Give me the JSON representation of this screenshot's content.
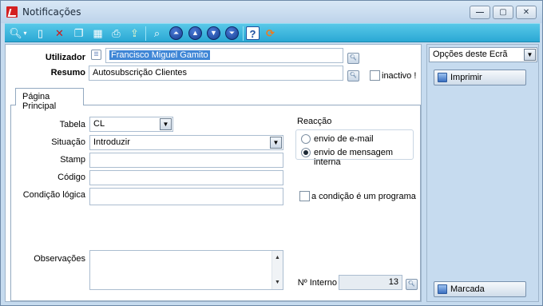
{
  "window": {
    "title": "Notificações"
  },
  "toolbar": {
    "icons": [
      "search-icon",
      "new-document-icon",
      "delete-icon",
      "copy-icon",
      "grid-icon",
      "print-icon",
      "export-icon",
      "preview-icon",
      "first-record-icon",
      "previous-record-icon",
      "next-record-icon",
      "last-record-icon",
      "help-icon",
      "refresh-icon"
    ]
  },
  "form": {
    "utilizador_label": "Utilizador",
    "utilizador_value": "Francisco Miguel Gamito",
    "resumo_label": "Resumo",
    "resumo_value": "Autosubscrição Clientes",
    "inactivo_label": "inactivo !",
    "inactivo_checked": false
  },
  "tabs": [
    {
      "label": "Página Principal",
      "active": true
    }
  ],
  "main": {
    "tabela_label": "Tabela",
    "tabela_value": "CL",
    "situacao_label": "Situação",
    "situacao_value": "Introduzir",
    "stamp_label": "Stamp",
    "stamp_value": "",
    "codigo_label": "Código",
    "codigo_value": "",
    "condicao_label": "Condição lógica",
    "condicao_value": "",
    "observacoes_label": "Observações",
    "observacoes_value": "",
    "reaccao_label": "Reacção",
    "reaccao_options": [
      {
        "label": "envio de e-mail",
        "selected": false
      },
      {
        "label": "envio de mensagem interna",
        "selected": true
      }
    ],
    "programa_label": "a condição é um programa",
    "programa_checked": false,
    "ninterno_label": "Nº Interno",
    "ninterno_value": "13"
  },
  "side": {
    "options_label": "Opções deste Ecrã",
    "buttons": [
      {
        "label": "Imprimir"
      },
      {
        "label": "Marcada"
      }
    ]
  },
  "colors": {
    "toolbar": "#2aa8d4",
    "selection": "#3f86d6",
    "window": "#c6dbef"
  }
}
